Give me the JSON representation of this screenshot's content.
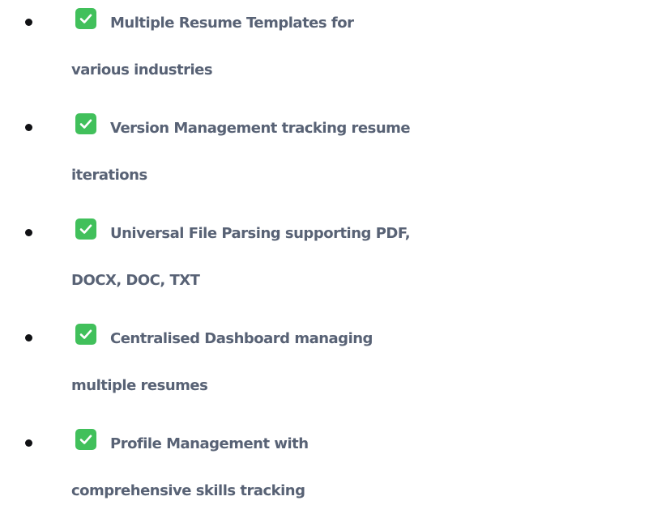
{
  "features": [
    {
      "line1": "Multiple Resume Templates for",
      "line2": "various industries"
    },
    {
      "line1": "Version Management tracking resume",
      "line2": "iterations"
    },
    {
      "line1": "Universal File Parsing supporting PDF,",
      "line2": "DOCX, DOC, TXT"
    },
    {
      "line1": "Centralised Dashboard managing",
      "line2": "multiple resumes"
    },
    {
      "line1": "Profile Management with",
      "line2": "comprehensive skills tracking"
    }
  ],
  "icons": {
    "check": "check-mark-button-icon",
    "bullet": "bullet-dot"
  },
  "colors": {
    "text": "#586275",
    "check_bg": "#41c05b",
    "bullet": "#101114"
  }
}
